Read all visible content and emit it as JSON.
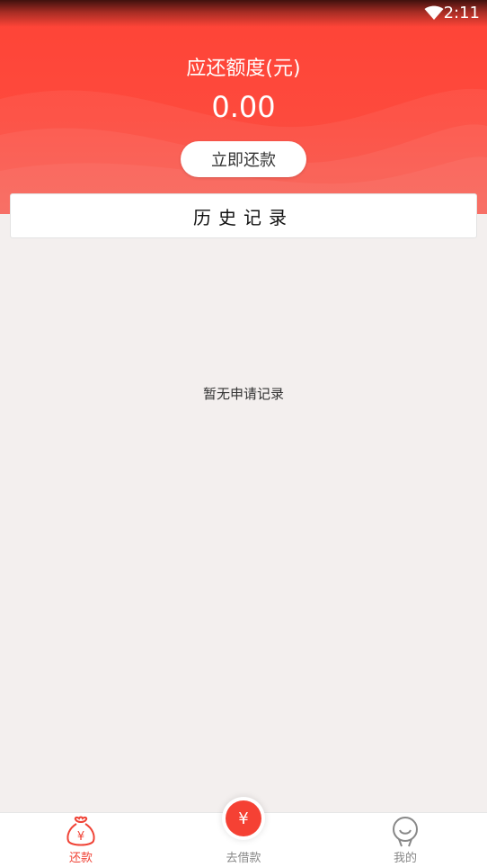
{
  "status_bar": {
    "time": "2:11",
    "wifi_icon": "wifi-icon"
  },
  "header": {
    "title": "应还额度(元)",
    "amount": "0.00",
    "repay_button": "立即还款",
    "accent_color": "#fd4a3d"
  },
  "history": {
    "title": "历史记录",
    "empty_text": "暂无申请记录"
  },
  "tabbar": {
    "items": [
      {
        "label": "还款",
        "icon": "money-bag-icon",
        "active": true
      },
      {
        "label": "去借款",
        "icon": "yuan-coin-icon",
        "active": false
      },
      {
        "label": "我的",
        "icon": "person-icon",
        "active": false
      }
    ],
    "active_color": "#f04336",
    "coin_symbol": "¥"
  }
}
